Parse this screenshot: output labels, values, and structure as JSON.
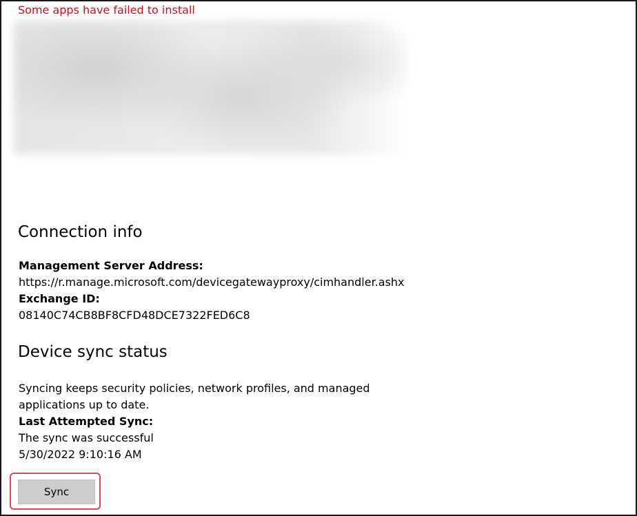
{
  "colors": {
    "error": "#c50f1f",
    "accent_highlight": "#e0484f",
    "button_bg": "#cccccc"
  },
  "status": {
    "error_message": "Some apps have failed to install"
  },
  "connection_info": {
    "heading": "Connection info",
    "management_server_label": "Management Server Address:",
    "management_server_value": "https://r.manage.microsoft.com/devicegatewayproxy/cimhandler.ashx",
    "exchange_id_label": "Exchange ID:",
    "exchange_id_value": "08140C74CB8BF8CFD48DCE7322FED6C8"
  },
  "device_sync": {
    "heading": "Device sync status",
    "description_line1": "Syncing keeps security policies, network profiles, and managed",
    "description_line2": "applications up to date.",
    "last_attempted_label": "Last Attempted Sync:",
    "last_attempted_status": "The sync was successful",
    "last_attempted_time": "5/30/2022 9:10:16 AM",
    "sync_button_label": "Sync"
  }
}
